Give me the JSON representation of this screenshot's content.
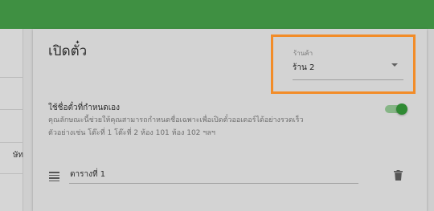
{
  "left_panel": {
    "cut_text": "ษัท"
  },
  "card": {
    "title": "เปิดตั๋ว",
    "store_select": {
      "label": "ร้านค้า",
      "value": "ร้าน 2"
    },
    "custom_ticket": {
      "title": "ใช้ชื่อตั๋วที่กำหนดเอง",
      "description": "คุณลักษณะนี้ช่วยให้คุณสามารถกำหนดชื่อเฉพาะเพื่อเปิดตั๋วออเดอร์ได้อย่างรวดเร็ว ตัวอย่างเช่น โต๊ะที่ 1 โต๊ะที่ 2 ห้อง 101 ห้อง 102 ฯลฯ",
      "enabled": true
    },
    "ticket_rows": [
      {
        "name": "ตารางที่ 1"
      }
    ]
  },
  "colors": {
    "topbar": "#3f9042",
    "highlight": "#f28c28",
    "toggle_on": "#2f8a33"
  }
}
